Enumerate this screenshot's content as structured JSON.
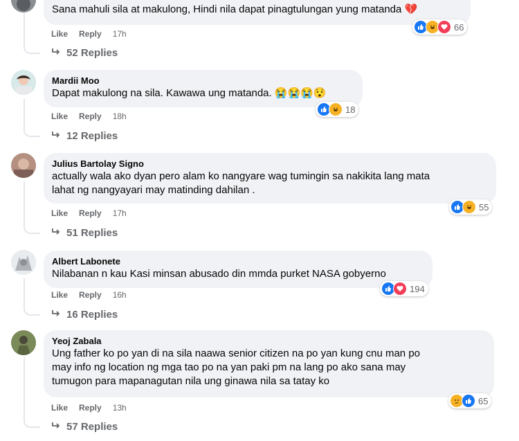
{
  "comments": [
    {
      "author": "",
      "lines": [
        "Sana mahuli sila at makulong, Hindi nila dapat pinagtulungan yung matanda 💔"
      ],
      "like": "Like",
      "reply": "Reply",
      "time": "17h",
      "reaction_count": "66",
      "reactions": [
        "like-icon",
        "haha-icon",
        "heart-icon"
      ],
      "replies": "52 Replies"
    },
    {
      "author": "Mardii Moo",
      "lines": [
        "Dapat makulong na sila. Kawawa ung matanda. 😭😭😭😯"
      ],
      "like": "Like",
      "reply": "Reply",
      "time": "18h",
      "reaction_count": "18",
      "reactions": [
        "like-icon",
        "haha-icon"
      ],
      "replies": "12 Replies"
    },
    {
      "author": "Julius Bartolay Signo",
      "lines": [
        "actually wala ako dyan pero alam ko nangyare wag tumingin sa nakikita lang mata",
        "lahat ng nangyayari may matinding dahilan ."
      ],
      "like": "Like",
      "reply": "Reply",
      "time": "17h",
      "reaction_count": "55",
      "reactions": [
        "like-icon",
        "haha-icon"
      ],
      "replies": "51 Replies"
    },
    {
      "author": "Albert Labonete",
      "lines": [
        "Nilabanan n kau Kasi minsan abusado din mmda purket NASA gobyerno"
      ],
      "like": "Like",
      "reply": "Reply",
      "time": "16h",
      "reaction_count": "194",
      "reactions": [
        "like-icon",
        "heart-icon"
      ],
      "replies": "16 Replies"
    },
    {
      "author": "Yeoj Zabala",
      "lines": [
        "Ung father ko po yan di na sila naawa senior citizen na po yan kung cnu man po",
        "may info ng location ng mga tao po na yan paki pm na lang po ako sana may",
        "tumugon para mapanagutan nila ung ginawa nila sa tatay ko"
      ],
      "like": "Like",
      "reply": "Reply",
      "time": "13h",
      "reaction_count": "65",
      "reactions": [
        "sad-icon",
        "like-icon"
      ],
      "replies": "57 Replies"
    }
  ],
  "colors": {
    "bubble": "#f0f2f5",
    "like_blue": "#1877f2",
    "heart_red": "#f33e58",
    "haha_yellow": "#f7b125",
    "muted_text": "#65676b"
  }
}
